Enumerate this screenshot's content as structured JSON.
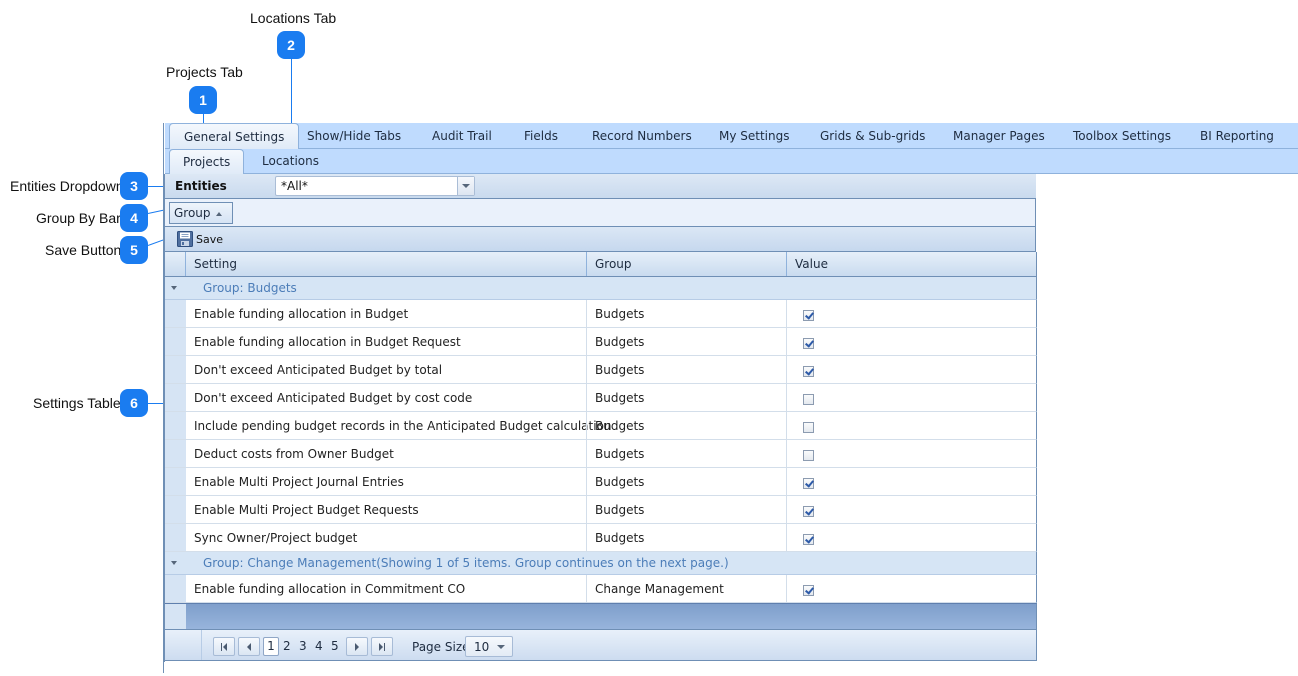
{
  "callouts": [
    {
      "number": "1",
      "label": "Projects Tab"
    },
    {
      "number": "2",
      "label": "Locations Tab"
    },
    {
      "number": "3",
      "label": "Entities Dropdown"
    },
    {
      "number": "4",
      "label": "Group By Bar"
    },
    {
      "number": "5",
      "label": "Save Button"
    },
    {
      "number": "6",
      "label": "Settings Table"
    }
  ],
  "outer_tabs": [
    {
      "label": "General Settings",
      "active": true
    },
    {
      "label": "Show/Hide Tabs"
    },
    {
      "label": "Audit Trail"
    },
    {
      "label": "Fields"
    },
    {
      "label": "Record Numbers"
    },
    {
      "label": "My Settings"
    },
    {
      "label": "Grids & Sub-grids"
    },
    {
      "label": "Manager Pages"
    },
    {
      "label": "Toolbox Settings"
    },
    {
      "label": "BI Reporting"
    }
  ],
  "inner_tabs": [
    {
      "label": "Projects",
      "active": true
    },
    {
      "label": "Locations"
    }
  ],
  "entities": {
    "label": "Entities",
    "value": "*All*"
  },
  "group_by": {
    "chip_label": "Group",
    "sort": "ascending"
  },
  "toolbar": {
    "save_label": "Save"
  },
  "grid": {
    "columns": [
      "Setting",
      "Group",
      "Value"
    ],
    "groups": [
      {
        "title": "Group: Budgets",
        "rows": [
          {
            "setting": "Enable funding allocation in Budget",
            "group": "Budgets",
            "value": true
          },
          {
            "setting": "Enable funding allocation in Budget Request",
            "group": "Budgets",
            "value": true
          },
          {
            "setting": "Don't exceed Anticipated Budget by total",
            "group": "Budgets",
            "value": true
          },
          {
            "setting": "Don't exceed Anticipated Budget by cost code",
            "group": "Budgets",
            "value": false
          },
          {
            "setting": "Include pending budget records in the Anticipated Budget calculation",
            "group": "Budgets",
            "value": false
          },
          {
            "setting": "Deduct costs from Owner Budget",
            "group": "Budgets",
            "value": false
          },
          {
            "setting": "Enable Multi Project Journal Entries",
            "group": "Budgets",
            "value": true
          },
          {
            "setting": "Enable Multi Project Budget Requests",
            "group": "Budgets",
            "value": true
          },
          {
            "setting": "Sync Owner/Project budget",
            "group": "Budgets",
            "value": true
          }
        ]
      },
      {
        "title": "Group: Change Management(Showing 1 of 5 items. Group continues on the next page.)",
        "rows": [
          {
            "setting": "Enable funding allocation in Commitment CO",
            "group": "Change Management",
            "value": true
          }
        ]
      }
    ]
  },
  "pager": {
    "pages": [
      "1",
      "2",
      "3",
      "4",
      "5"
    ],
    "current_page": "1",
    "page_size_label": "Page Size",
    "page_size": "10"
  },
  "colors": {
    "callout_blue": "#1a7cf0",
    "tab_strip": "#bfdbfe",
    "group_title": "#4c7db8",
    "checkbox_check": "#2d5aa8"
  }
}
